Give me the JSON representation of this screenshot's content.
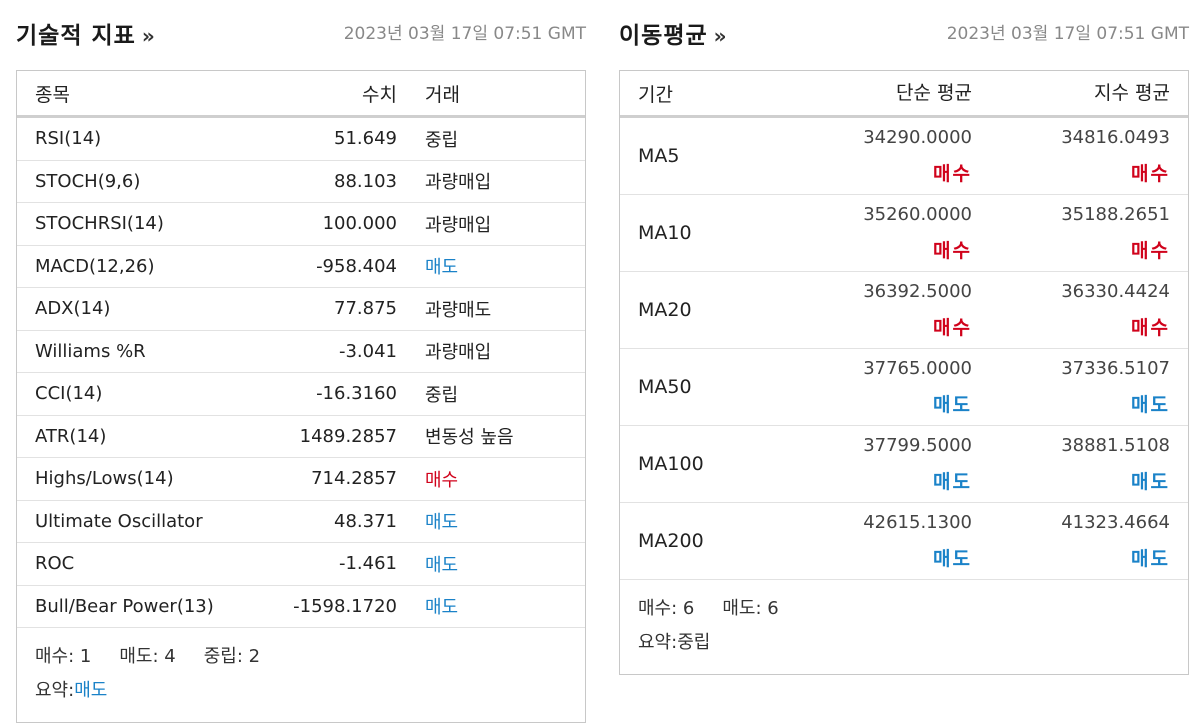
{
  "technical": {
    "title": "기술적 지표",
    "chevron": "»",
    "timestamp": "2023년 03월 17일 07:51 GMT",
    "headers": {
      "name": "종목",
      "value": "수치",
      "action": "거래"
    },
    "rows": [
      {
        "name": "RSI(14)",
        "value": "51.649",
        "action": "중립",
        "tone": "neutral"
      },
      {
        "name": "STOCH(9,6)",
        "value": "88.103",
        "action": "과량매입",
        "tone": "other"
      },
      {
        "name": "STOCHRSI(14)",
        "value": "100.000",
        "action": "과량매입",
        "tone": "other"
      },
      {
        "name": "MACD(12,26)",
        "value": "-958.404",
        "action": "매도",
        "tone": "sell"
      },
      {
        "name": "ADX(14)",
        "value": "77.875",
        "action": "과량매도",
        "tone": "other"
      },
      {
        "name": "Williams %R",
        "value": "-3.041",
        "action": "과량매입",
        "tone": "other"
      },
      {
        "name": "CCI(14)",
        "value": "-16.3160",
        "action": "중립",
        "tone": "neutral"
      },
      {
        "name": "ATR(14)",
        "value": "1489.2857",
        "action": "변동성 높음",
        "tone": "other"
      },
      {
        "name": "Highs/Lows(14)",
        "value": "714.2857",
        "action": "매수",
        "tone": "buy"
      },
      {
        "name": "Ultimate Oscillator",
        "value": "48.371",
        "action": "매도",
        "tone": "sell"
      },
      {
        "name": "ROC",
        "value": "-1.461",
        "action": "매도",
        "tone": "sell"
      },
      {
        "name": "Bull/Bear Power(13)",
        "value": "-1598.1720",
        "action": "매도",
        "tone": "sell"
      }
    ],
    "summary": {
      "buy": "매수: 1",
      "sell": "매도: 4",
      "neutral": "중립: 2",
      "label": "요약:",
      "verdict": "매도"
    }
  },
  "moving_averages": {
    "title": "이동평균",
    "chevron": "»",
    "timestamp": "2023년 03월 17일 07:51 GMT",
    "headers": {
      "period": "기간",
      "simple": "단순 평균",
      "exponential": "지수 평균"
    },
    "rows": [
      {
        "period": "MA5",
        "simple": "34290.0000",
        "simple_action": "매수",
        "exp": "34816.0493",
        "exp_action": "매수"
      },
      {
        "period": "MA10",
        "simple": "35260.0000",
        "simple_action": "매수",
        "exp": "35188.2651",
        "exp_action": "매수"
      },
      {
        "period": "MA20",
        "simple": "36392.5000",
        "simple_action": "매수",
        "exp": "36330.4424",
        "exp_action": "매수"
      },
      {
        "period": "MA50",
        "simple": "37765.0000",
        "simple_action": "매도",
        "exp": "37336.5107",
        "exp_action": "매도"
      },
      {
        "period": "MA100",
        "simple": "37799.5000",
        "simple_action": "매도",
        "exp": "38881.5108",
        "exp_action": "매도"
      },
      {
        "period": "MA200",
        "simple": "42615.1300",
        "simple_action": "매도",
        "exp": "41323.4664",
        "exp_action": "매도"
      }
    ],
    "summary": {
      "buy": "매수: 6",
      "sell": "매도: 6",
      "label": "요약:",
      "verdict": "중립"
    }
  },
  "colors": {
    "buy": "#d0021b",
    "sell": "#1a82c8",
    "text": "#222222",
    "border": "#c8c8c8",
    "muted": "#888888"
  }
}
